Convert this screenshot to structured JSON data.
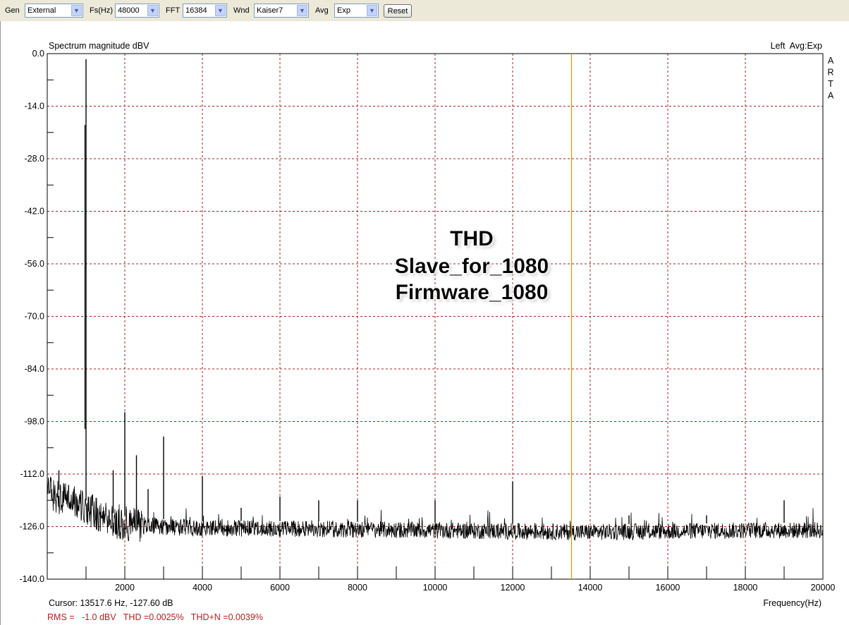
{
  "toolbar": {
    "gen_label": "Gen",
    "gen_value": "External",
    "fs_label": "Fs(Hz)",
    "fs_value": "48000",
    "fft_label": "FFT",
    "fft_value": "16384",
    "wnd_label": "Wnd",
    "wnd_value": "Kaiser7",
    "avg_label": "Avg",
    "avg_value": "Exp",
    "reset_label": "Reset"
  },
  "icons": {
    "dropdown": "chevron-down-icon"
  },
  "chart_data": {
    "type": "line",
    "title": "Spectrum magnitude dBV",
    "status_right": "Left  Avg:Exp",
    "brand": "ARTA",
    "xlabel": "Frequency(Hz)",
    "xlim": [
      0,
      20000
    ],
    "ylim": [
      -140,
      0
    ],
    "x_ticks": [
      2000,
      4000,
      6000,
      8000,
      10000,
      12000,
      14000,
      16000,
      18000,
      20000
    ],
    "x_tick_labels": [
      "2000",
      "4000",
      "6000",
      "8000",
      "10000",
      "12000",
      "14000",
      "16000",
      "18000",
      "20000"
    ],
    "y_ticks": [
      0,
      -14,
      -28,
      -42,
      -56,
      -70,
      -84,
      -98,
      -112,
      -126,
      -140
    ],
    "y_tick_labels": [
      "0.0",
      "-14.0",
      "-28.0",
      "-42.0",
      "-56.0",
      "-70.0",
      "-84.0",
      "-98.0",
      "-112.0",
      "-126.0",
      "-140.0"
    ],
    "grid": true,
    "noise_floor": [
      [
        0,
        -117
      ],
      [
        500,
        -119
      ],
      [
        1000,
        -121
      ],
      [
        1500,
        -124
      ],
      [
        2000,
        -125
      ],
      [
        3000,
        -126
      ],
      [
        4000,
        -126.5
      ],
      [
        6000,
        -126.5
      ],
      [
        10000,
        -127
      ],
      [
        14000,
        -127.5
      ],
      [
        18000,
        -127
      ],
      [
        20000,
        -127
      ]
    ],
    "peaks": [
      [
        1000,
        -1.5
      ],
      [
        2000,
        -95.5
      ],
      [
        3000,
        -102
      ],
      [
        4000,
        -112.5
      ],
      [
        5000,
        -121
      ],
      [
        6000,
        -118
      ],
      [
        7000,
        -119
      ],
      [
        8000,
        -119
      ],
      [
        10000,
        -119
      ],
      [
        12000,
        -114
      ],
      [
        15000,
        -123
      ],
      [
        17000,
        -123
      ],
      [
        19000,
        -119
      ],
      [
        1700,
        -111
      ],
      [
        2300,
        -107
      ],
      [
        2600,
        -116
      ],
      [
        300,
        -111
      ]
    ],
    "cursor_freq": 13517.6,
    "cursor_readout": "Cursor: 13517.6 Hz, -127.60 dB",
    "rms_readout": "RMS =   -1.0 dBV   THD =0.0025%   THD+N =0.0039%",
    "annotation_lines": [
      "THD",
      "Slave_for_1080",
      "Firmware_1080"
    ],
    "colors": {
      "trace": "#000000",
      "grid": "#a02020",
      "cursor": "#d4a10a",
      "readout": "#b22222"
    }
  }
}
